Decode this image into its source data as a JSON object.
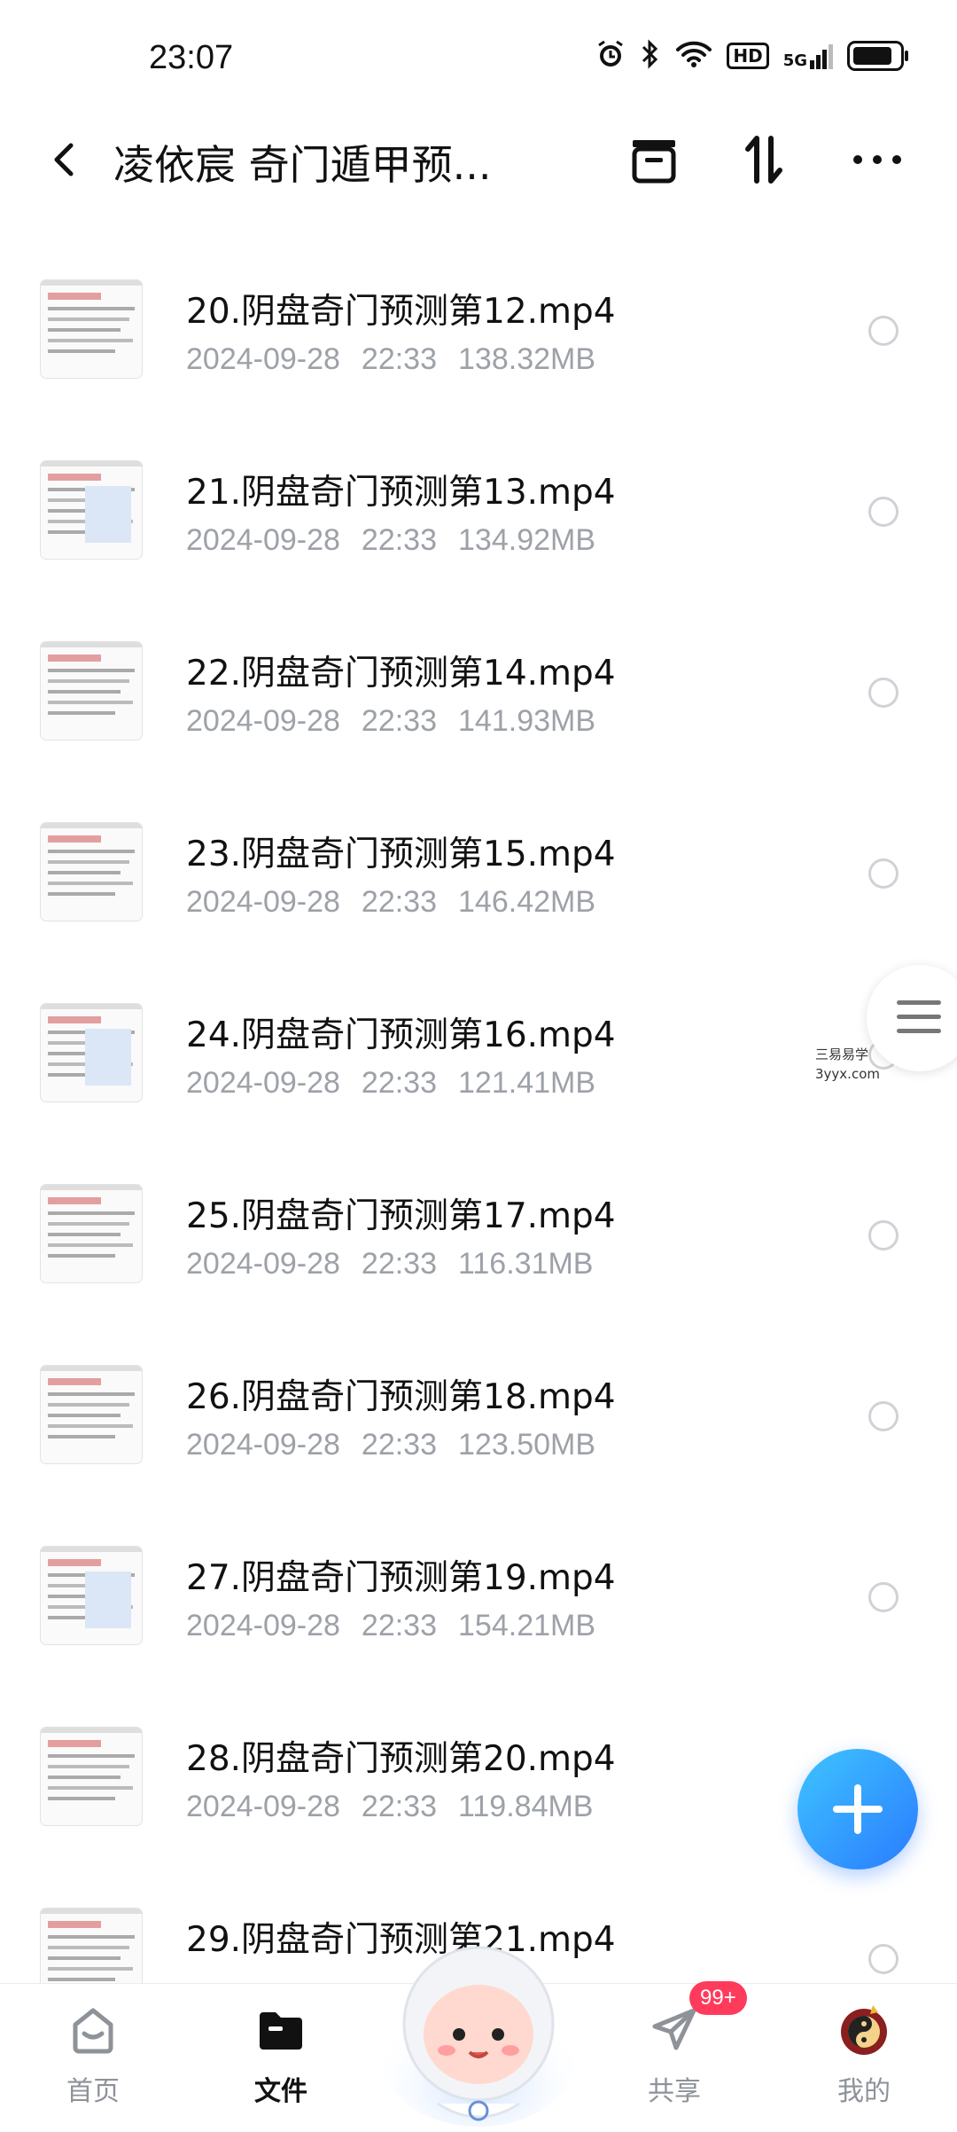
{
  "status_bar": {
    "time": "23:07",
    "hd": "HD",
    "network": "5G",
    "battery_level": 0.85
  },
  "header": {
    "title": "凌依宸 奇门遁甲预..."
  },
  "files": [
    {
      "name": "20.阴盘奇门预测第12.mp4",
      "date": "2024-09-28",
      "time": "22:33",
      "size": "138.32MB"
    },
    {
      "name": "21.阴盘奇门预测第13.mp4",
      "date": "2024-09-28",
      "time": "22:33",
      "size": "134.92MB"
    },
    {
      "name": "22.阴盘奇门预测第14.mp4",
      "date": "2024-09-28",
      "time": "22:33",
      "size": "141.93MB"
    },
    {
      "name": "23.阴盘奇门预测第15.mp4",
      "date": "2024-09-28",
      "time": "22:33",
      "size": "146.42MB"
    },
    {
      "name": "24.阴盘奇门预测第16.mp4",
      "date": "2024-09-28",
      "time": "22:33",
      "size": "121.41MB"
    },
    {
      "name": "25.阴盘奇门预测第17.mp4",
      "date": "2024-09-28",
      "time": "22:33",
      "size": "116.31MB"
    },
    {
      "name": "26.阴盘奇门预测第18.mp4",
      "date": "2024-09-28",
      "time": "22:33",
      "size": "123.50MB"
    },
    {
      "name": "27.阴盘奇门预测第19.mp4",
      "date": "2024-09-28",
      "time": "22:33",
      "size": "154.21MB"
    },
    {
      "name": "28.阴盘奇门预测第20.mp4",
      "date": "2024-09-28",
      "time": "22:33",
      "size": "119.84MB"
    },
    {
      "name": "29.阴盘奇门预测第21.mp4",
      "date": "",
      "time": "",
      "size": ""
    }
  ],
  "watermark": {
    "line1": "三易易学",
    "line2": "3yyx.com"
  },
  "bottom_nav": {
    "home": "首页",
    "files": "文件",
    "share": "共享",
    "mine": "我的",
    "share_badge": "99+"
  },
  "colors": {
    "accent": "#2a7bff",
    "badge": "#ff3b5c",
    "meta_text": "#9da1a8"
  }
}
